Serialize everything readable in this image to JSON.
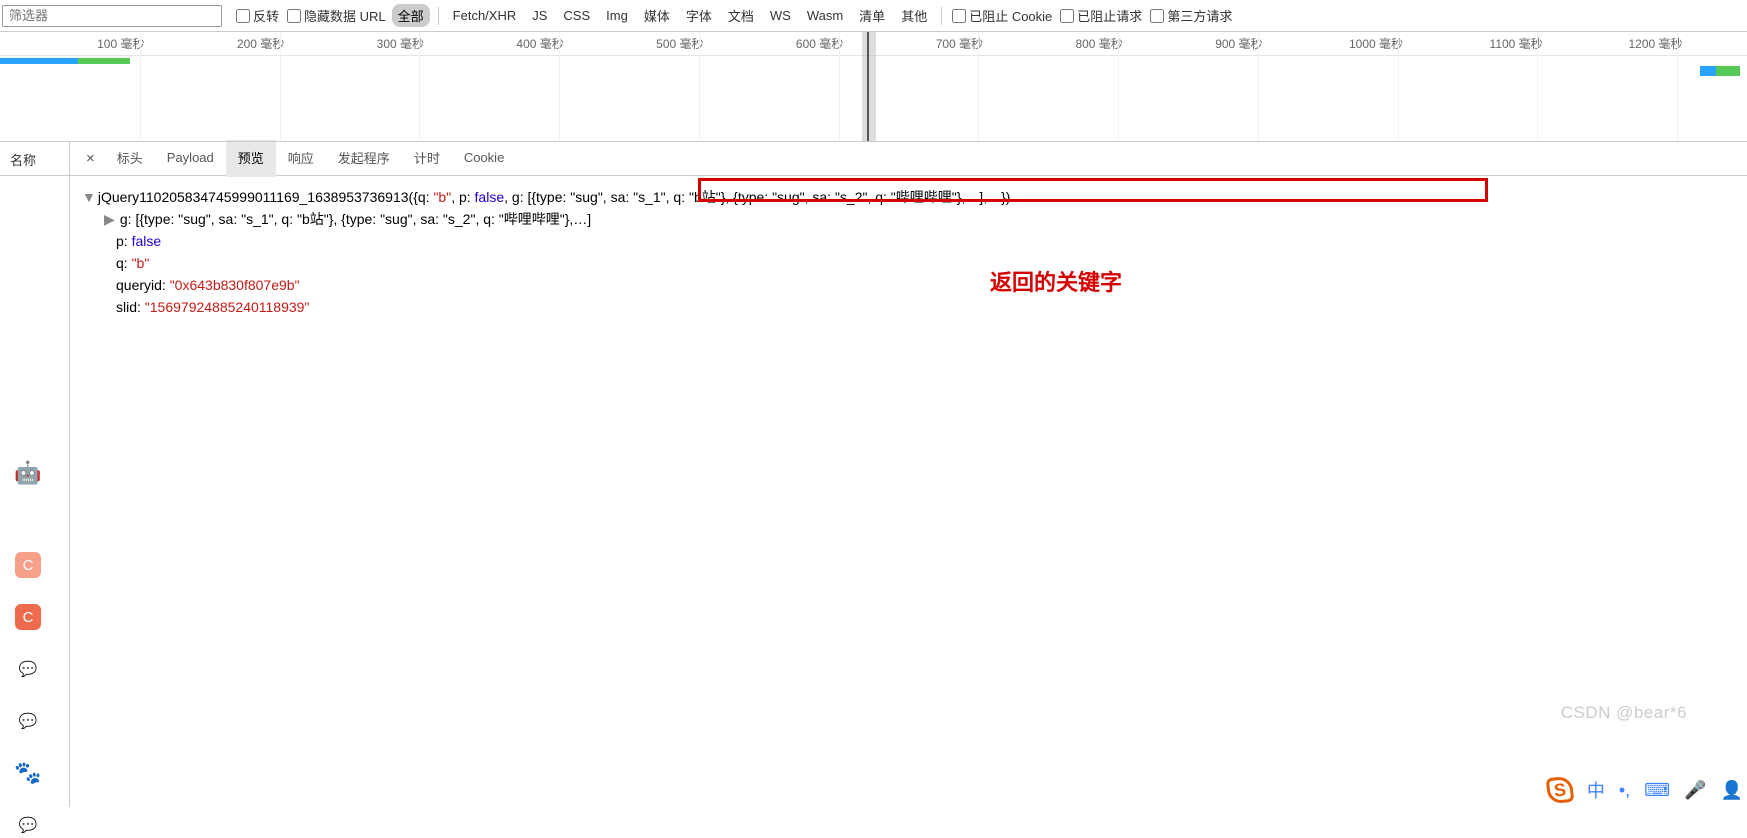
{
  "filter": {
    "placeholder": "筛选器",
    "invert": "反转",
    "hide_data_url": "隐藏数据 URL"
  },
  "resourceTypes": {
    "all": "全部",
    "fetch": "Fetch/XHR",
    "js": "JS",
    "css": "CSS",
    "img": "Img",
    "media": "媒体",
    "font": "字体",
    "doc": "文档",
    "ws": "WS",
    "wasm": "Wasm",
    "manifest": "清单",
    "other": "其他"
  },
  "blocking": {
    "blocked_cookies": "已阻止 Cookie",
    "blocked_requests": "已阻止请求",
    "third_party": "第三方请求"
  },
  "timeline": {
    "unit": "毫秒",
    "ticks": [
      100,
      200,
      300,
      400,
      500,
      600,
      700,
      800,
      900,
      1000,
      1100,
      1200
    ]
  },
  "nameHeader": "名称",
  "detailTabs": {
    "close": "×",
    "headers": "标头",
    "payload": "Payload",
    "preview": "预览",
    "response": "响应",
    "initiator": "发起程序",
    "timing": "计时",
    "cookies": "Cookie"
  },
  "preview": {
    "callback_prefix": "jQuery110205834745999011169_1638953736913(",
    "root": {
      "q": "b",
      "p": "false",
      "g_repr_line": "g: [{type: \"sug\", sa: \"s_1\", q: \"b站\"}, {type: \"sug\", sa: \"s_2\", q: \"哔哩哔哩\"},…],…})",
      "g_child_line": "g: [{type: \"sug\", sa: \"s_1\", q: \"b站\"}, {type: \"sug\", sa: \"s_2\", q: \"哔哩哔哩\"},…]",
      "p_line": "p: ",
      "p_val": "false",
      "q_line": "q: ",
      "q_val": "\"b\"",
      "queryid_line": "queryid: ",
      "queryid_val": "\"0x643b830f807e9b\"",
      "slid_line": "slid: ",
      "slid_val": "\"15697924885240118939\""
    }
  },
  "annotation": {
    "label": "返回的关键字"
  },
  "watermark": "CSDN @bear*6"
}
